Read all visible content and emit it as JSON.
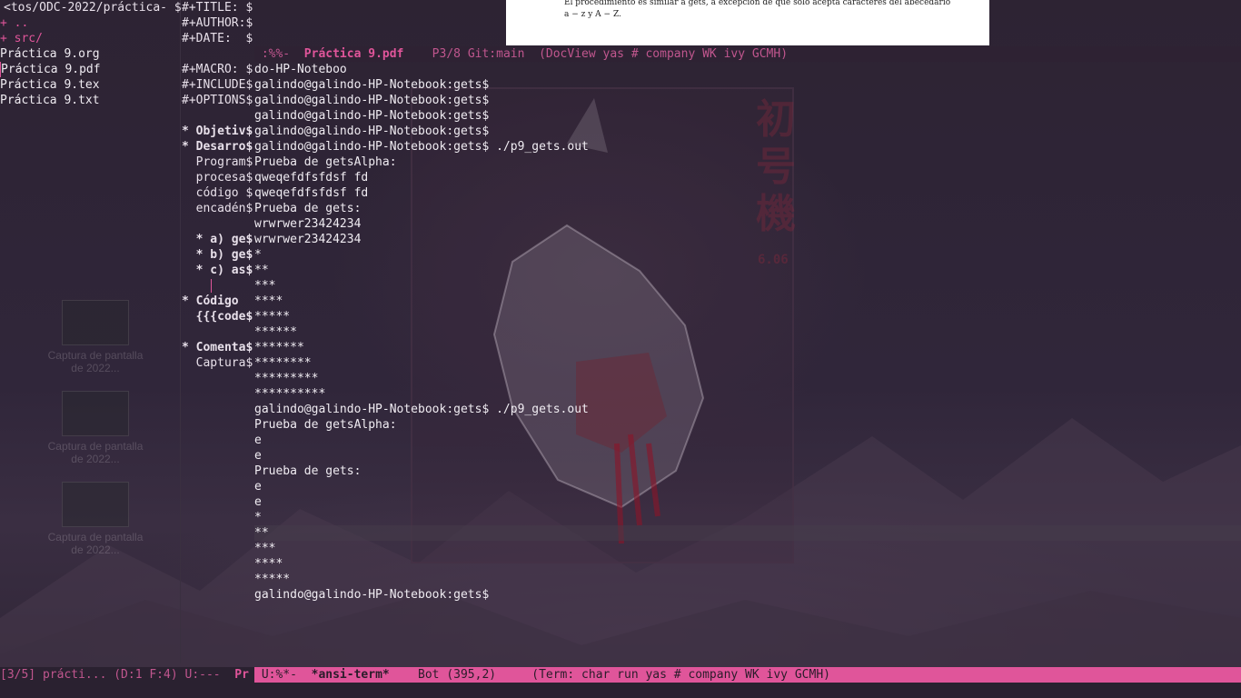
{
  "dired": {
    "header": "<tos/ODC-2022/práctica- $",
    "entries": [
      {
        "text": "+ ..",
        "kind": "dir"
      },
      {
        "text": "+ src/",
        "kind": "dir"
      },
      {
        "text": "Práctica 9.org",
        "kind": "file"
      },
      {
        "text": "Práctica 9.pdf",
        "kind": "file"
      },
      {
        "text": "Práctica 9.tex",
        "kind": "file"
      },
      {
        "text": "Práctica 9.txt",
        "kind": "file"
      }
    ]
  },
  "org": {
    "lines": [
      "#+TITLE: $",
      "#+AUTHOR:$",
      "#+DATE:  $",
      "",
      "#+MACRO: $",
      "#+INCLUDE$",
      "#+OPTIONS$",
      "",
      "* Objetiv$",
      "* Desarro$",
      "  Program$",
      "  procesa$",
      "  código $",
      "  encadén$",
      "",
      "  * a) ge$",
      "  * b) ge$",
      "  * c) as$",
      "",
      "* Código ",
      "  {{{code$",
      "",
      "* Comenta$",
      "  Captura$"
    ]
  },
  "docview": {
    "text_line1": "El procedimiento es similar a gets, a excepción de que solo acepta caracteres del abecedario",
    "text_line2": "a − z y A − Z.",
    "mode_prefix": " :%%-  ",
    "buffer_name": "Práctica 9.pdf",
    "mode_rest": "    P3/8 Git:main  (DocView yas # company WK ivy GCMH)"
  },
  "terminal": {
    "lines": [
      "do-HP-Noteboo",
      "galindo@galindo-HP-Notebook:gets$",
      "galindo@galindo-HP-Notebook:gets$",
      "galindo@galindo-HP-Notebook:gets$",
      "galindo@galindo-HP-Notebook:gets$",
      "galindo@galindo-HP-Notebook:gets$ ./p9_gets.out",
      "Prueba de getsAlpha:",
      "qweqefdfsfdsf fd",
      "qweqefdfsfdsf fd",
      "Prueba de gets:",
      "wrwrwer23424234",
      "wrwrwer23424234",
      "*",
      "**",
      "***",
      "****",
      "*****",
      "******",
      "*******",
      "********",
      "*********",
      "**********",
      "galindo@galindo-HP-Notebook:gets$ ./p9_gets.out",
      "Prueba de getsAlpha:",
      "e",
      "e",
      "Prueba de gets:",
      "e",
      "e",
      "*",
      "**",
      "***",
      "****",
      "*****",
      "galindo@galindo-HP-Notebook:gets$"
    ]
  },
  "modeline_left": {
    "text": "[3/5] prácti... (D:1 F:4) U:---  ",
    "tail": "Pr"
  },
  "modeline_term": {
    "prefix": " U:%*-  ",
    "buffer_name": "*ansi-term*",
    "rest": "    Bot (395,2)     (Term: char run yas # company WK ivy GCMH)"
  },
  "desktop_icons": [
    {
      "label": "Captura de pantalla de 2022..."
    },
    {
      "label": "Captura de pantalla de 2022..."
    },
    {
      "label": "Captura de pantalla de 2022..."
    }
  ],
  "poster": {
    "kanji": "初号機",
    "number": "6.06"
  },
  "colors": {
    "accent": "#e0559a",
    "heading": "#45b7c4",
    "background": "#2a2130"
  }
}
